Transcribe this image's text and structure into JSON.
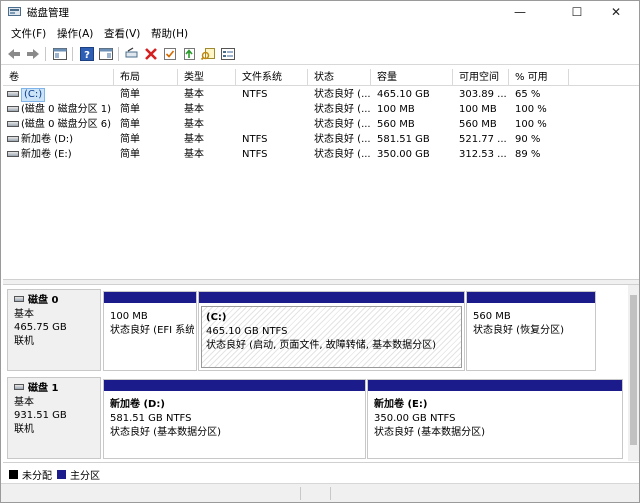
{
  "window": {
    "title": "磁盘管理",
    "minimize": "—",
    "maximize": "☐",
    "close": "✕"
  },
  "menu": [
    "文件(F)",
    "操作(A)",
    "查看(V)",
    "帮助(H)"
  ],
  "columns": [
    "卷",
    "布局",
    "类型",
    "文件系统",
    "状态",
    "容量",
    "可用空间",
    "% 可用"
  ],
  "volumes": [
    {
      "name": "(C:)",
      "layout": "简单",
      "type": "基本",
      "fs": "NTFS",
      "status": "状态良好 (...",
      "capacity": "465.10 GB",
      "free": "303.89 ...",
      "pct": "65 %"
    },
    {
      "name": "(磁盘 0 磁盘分区 1)",
      "layout": "简单",
      "type": "基本",
      "fs": "",
      "status": "状态良好 (...",
      "capacity": "100 MB",
      "free": "100 MB",
      "pct": "100 %"
    },
    {
      "name": "(磁盘 0 磁盘分区 6)",
      "layout": "简单",
      "type": "基本",
      "fs": "",
      "status": "状态良好 (...",
      "capacity": "560 MB",
      "free": "560 MB",
      "pct": "100 %"
    },
    {
      "name": "新加卷 (D:)",
      "layout": "简单",
      "type": "基本",
      "fs": "NTFS",
      "status": "状态良好 (...",
      "capacity": "581.51 GB",
      "free": "521.77 ...",
      "pct": "90 %"
    },
    {
      "name": "新加卷 (E:)",
      "layout": "简单",
      "type": "基本",
      "fs": "NTFS",
      "status": "状态良好 (...",
      "capacity": "350.00 GB",
      "free": "312.53 ...",
      "pct": "89 %"
    }
  ],
  "disks": [
    {
      "name": "磁盘 0",
      "kind": "基本",
      "size": "465.75 GB",
      "state": "联机",
      "partitions": [
        {
          "name": "",
          "size": "100 MB",
          "status": "状态良好 (EFI 系统"
        },
        {
          "name": "(C:)",
          "size": "465.10 GB NTFS",
          "status": "状态良好 (启动, 页面文件, 故障转储, 基本数据分区)"
        },
        {
          "name": "",
          "size": "560 MB",
          "status": "状态良好 (恢复分区)"
        }
      ]
    },
    {
      "name": "磁盘 1",
      "kind": "基本",
      "size": "931.51 GB",
      "state": "联机",
      "partitions": [
        {
          "name": "新加卷 (D:)",
          "size": "581.51 GB NTFS",
          "status": "状态良好 (基本数据分区)"
        },
        {
          "name": "新加卷 (E:)",
          "size": "350.00 GB NTFS",
          "status": "状态良好 (基本数据分区)"
        }
      ]
    }
  ],
  "legend": [
    {
      "label": "未分配",
      "color": "#000000"
    },
    {
      "label": "主分区",
      "color": "#1b1b8c"
    }
  ],
  "colors": {
    "partition_bar": "#1b1b8c",
    "selection": "#cce4f7"
  },
  "toolbar_icons": [
    "back-arrow-icon",
    "forward-arrow-icon",
    "console-view-icon",
    "help-icon",
    "properties-view-icon",
    "connect-disk-icon",
    "delete-icon",
    "check-icon",
    "export-icon",
    "search-icon",
    "list-view-icon"
  ]
}
